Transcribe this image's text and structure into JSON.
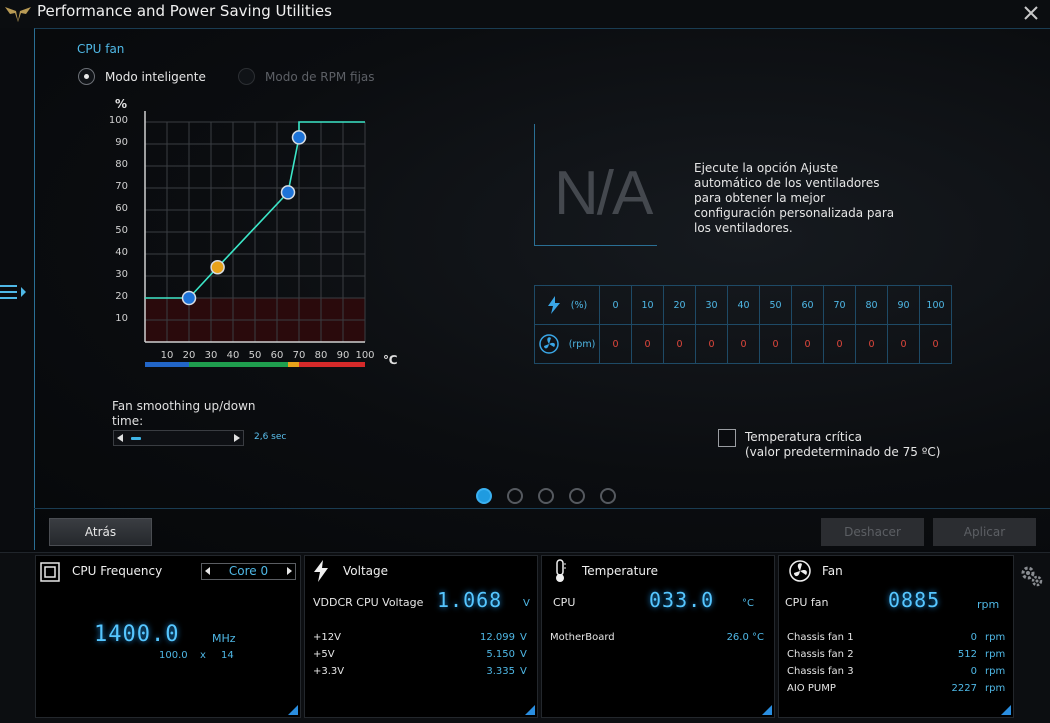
{
  "window": {
    "title": "Performance and Power Saving Utilities"
  },
  "fan_control": {
    "section_title": "CPU fan",
    "modes": [
      {
        "label": "Modo inteligente",
        "selected": true,
        "enabled": true
      },
      {
        "label": "Modo de RPM fijas",
        "selected": false,
        "enabled": false
      }
    ],
    "y_unit": "%",
    "x_unit": "℃",
    "y_ticks": [
      "100",
      "90",
      "80",
      "70",
      "60",
      "50",
      "40",
      "30",
      "20",
      "10"
    ],
    "x_ticks": [
      "10",
      "20",
      "30",
      "40",
      "50",
      "60",
      "70",
      "80",
      "90",
      "100"
    ],
    "curve_points": [
      {
        "temp": 20,
        "pct": 20,
        "color": "#1e73d8"
      },
      {
        "temp": 33,
        "pct": 34,
        "color": "#e8a21a"
      },
      {
        "temp": 65,
        "pct": 68,
        "color": "#1e73d8"
      },
      {
        "temp": 70,
        "pct": 93,
        "color": "#1e73d8"
      }
    ],
    "smoothing_label": "Fan smoothing up/down time:",
    "smoothing_value": "2,6 sec",
    "smoothing_level": 0.1
  },
  "tuning": {
    "status": "N/A",
    "hint": "Ejecute la opción Ajuste automático de los ventiladores para obtener la mejor configuración personalizada para los ventiladores."
  },
  "fan_table": {
    "pct_label": "(%)",
    "rpm_label": "(rpm)",
    "pct": [
      "0",
      "10",
      "20",
      "30",
      "40",
      "50",
      "60",
      "70",
      "80",
      "90",
      "100"
    ],
    "rpm": [
      "0",
      "0",
      "0",
      "0",
      "0",
      "0",
      "0",
      "0",
      "0",
      "0",
      "0"
    ]
  },
  "critical_temp": {
    "label": "Temperatura crítica",
    "sublabel": "(valor predeterminado de 75 ºC)",
    "checked": false
  },
  "pager": {
    "count": 5,
    "active": 0
  },
  "buttons": {
    "back": "Atrás",
    "undo": "Deshacer",
    "apply": "Aplicar"
  },
  "cpu_freq": {
    "title": "CPU Frequency",
    "core": "Core 0",
    "value": "1400.0",
    "unit": "MHz",
    "bclk": "100.0",
    "x": "x",
    "ratio": "14"
  },
  "voltage": {
    "title": "Voltage",
    "main_label": "VDDCR CPU Voltage",
    "main_value": "1.068",
    "main_unit": "V",
    "rows": [
      {
        "label": "+12V",
        "value": "12.099",
        "unit": "V"
      },
      {
        "label": "+5V",
        "value": "5.150",
        "unit": "V"
      },
      {
        "label": "+3.3V",
        "value": "3.335",
        "unit": "V"
      }
    ]
  },
  "temperature": {
    "title": "Temperature",
    "main_label": "CPU",
    "main_value": "033.0",
    "main_unit": "°C",
    "rows": [
      {
        "label": "MotherBoard",
        "value": "26.0 °C"
      }
    ]
  },
  "fan": {
    "title": "Fan",
    "main_label": "CPU fan",
    "main_value": "0885",
    "main_unit": "rpm",
    "rows": [
      {
        "label": "Chassis fan 1",
        "value": "0",
        "unit": "rpm"
      },
      {
        "label": "Chassis fan 2",
        "value": "512",
        "unit": "rpm"
      },
      {
        "label": "Chassis fan 3",
        "value": "0",
        "unit": "rpm"
      },
      {
        "label": "AIO PUMP",
        "value": "2227",
        "unit": "rpm"
      }
    ]
  },
  "colors": {
    "accent": "#4fb8e6",
    "curve": "#3ce6c8",
    "danger_zone": "#2a0a0c",
    "temp_bar": [
      "#2266c8",
      "#1f9e4e",
      "#e8a21a",
      "#d62a2a"
    ]
  }
}
